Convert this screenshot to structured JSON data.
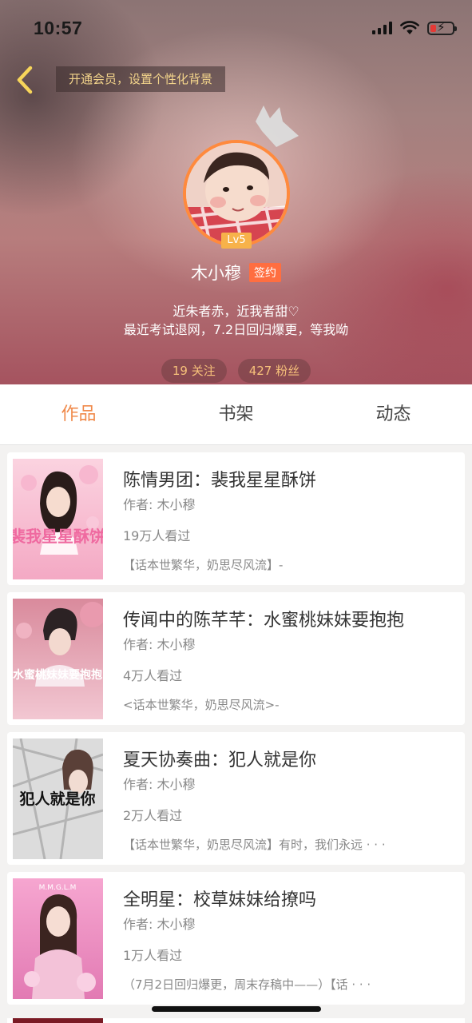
{
  "status_bar": {
    "time": "10:57"
  },
  "header": {
    "vip_banner": "开通会员，设置个性化背景",
    "level": "Lv5",
    "name": "木小穆",
    "sign_badge": "签约",
    "bio_line1": "近朱者赤，近我者甜♡",
    "bio_line2": "最近考试退网，7.2日回归爆更，等我呦",
    "following": "19 关注",
    "followers": "427 粉丝"
  },
  "tabs": [
    "作品",
    "书架",
    "动态"
  ],
  "books": [
    {
      "title": "陈情男团：裴我星星酥饼",
      "author": "作者: 木小穆",
      "views": "19万人看过",
      "intro": "【话本世繁华，奶思尽风流】-",
      "cover_text": "裴我星星酥饼"
    },
    {
      "title": "传闻中的陈芊芊：水蜜桃妹妹要抱抱",
      "author": "作者: 木小穆",
      "views": "4万人看过",
      "intro": "<话本世繁华，奶思尽风流>-",
      "cover_text": "水蜜桃妹妹要抱抱"
    },
    {
      "title": "夏天协奏曲：犯人就是你",
      "author": "作者: 木小穆",
      "views": "2万人看过",
      "intro": "【话本世繁华，奶思尽风流】有时，我们永远 · · ·",
      "cover_text": "犯人就是你"
    },
    {
      "title": "全明星：校草妹妹给撩吗",
      "author": "作者: 木小穆",
      "views": "1万人看过",
      "intro": "（7月2日回归爆更，周末存稿中——）【话 · · ·",
      "cover_text": "M.M.G.L.M"
    }
  ],
  "colors": {
    "accent": "#f08a4b",
    "avatar_border": "#ff8a3d",
    "level_badge": "#f7b24a",
    "sign_badge": "#ff6e40",
    "banner_text": "#f3d48b"
  }
}
